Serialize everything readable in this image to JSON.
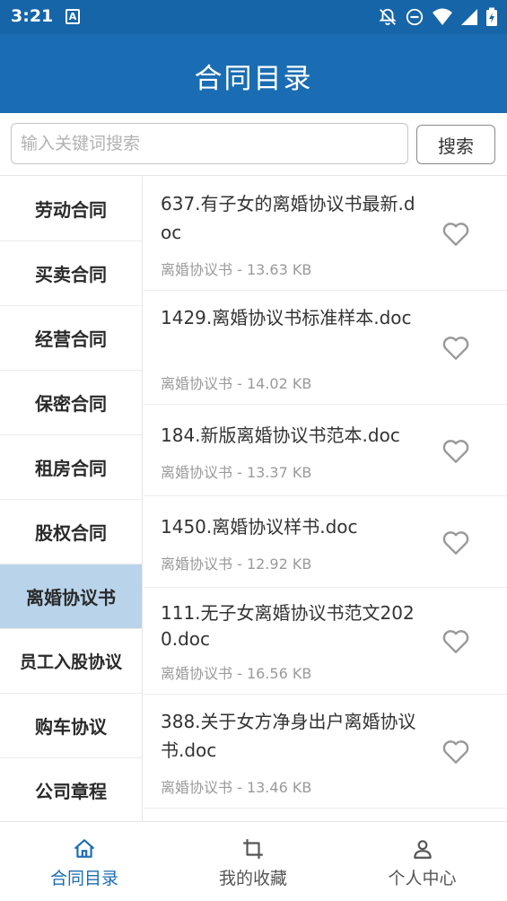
{
  "status_bar": {
    "time": "3:21",
    "notification_glyph": "A"
  },
  "header": {
    "title": "合同目录"
  },
  "search": {
    "placeholder": "输入关键词搜索",
    "value": "",
    "button_label": "搜索"
  },
  "categories": [
    {
      "label": "劳动合同",
      "active": false
    },
    {
      "label": "买卖合同",
      "active": false
    },
    {
      "label": "经营合同",
      "active": false
    },
    {
      "label": "保密合同",
      "active": false
    },
    {
      "label": "租房合同",
      "active": false
    },
    {
      "label": "股权合同",
      "active": false
    },
    {
      "label": "离婚协议书",
      "active": true
    },
    {
      "label": "员工入股协议",
      "active": false
    },
    {
      "label": "购车协议",
      "active": false
    },
    {
      "label": "公司章程",
      "active": false
    }
  ],
  "files": [
    {
      "title": "637.有子女的离婚协议书最新.doc",
      "meta": "离婚协议书 - 13.63 KB"
    },
    {
      "title": "1429.离婚协议书标准样本.doc",
      "meta": "离婚协议书 - 14.02 KB"
    },
    {
      "title": "184.新版离婚协议书范本.doc",
      "meta": "离婚协议书 - 13.37 KB"
    },
    {
      "title": "1450.离婚协议样书.doc",
      "meta": "离婚协议书 - 12.92 KB"
    },
    {
      "title": "111.无子女离婚协议书范文2020.doc",
      "meta": "离婚协议书 - 16.56 KB"
    },
    {
      "title": "388.关于女方净身出户离婚协议书.doc",
      "meta": "离婚协议书 - 13.46 KB"
    }
  ],
  "bottom_nav": [
    {
      "label": "合同目录",
      "icon": "home-icon",
      "active": true
    },
    {
      "label": "我的收藏",
      "icon": "crop-icon",
      "active": false
    },
    {
      "label": "个人中心",
      "icon": "user-icon",
      "active": false
    }
  ],
  "colors": {
    "primary": "#1a6db2",
    "status_bar": "#1565a8",
    "active_category": "#b9d4ea",
    "heart": "#999999"
  }
}
